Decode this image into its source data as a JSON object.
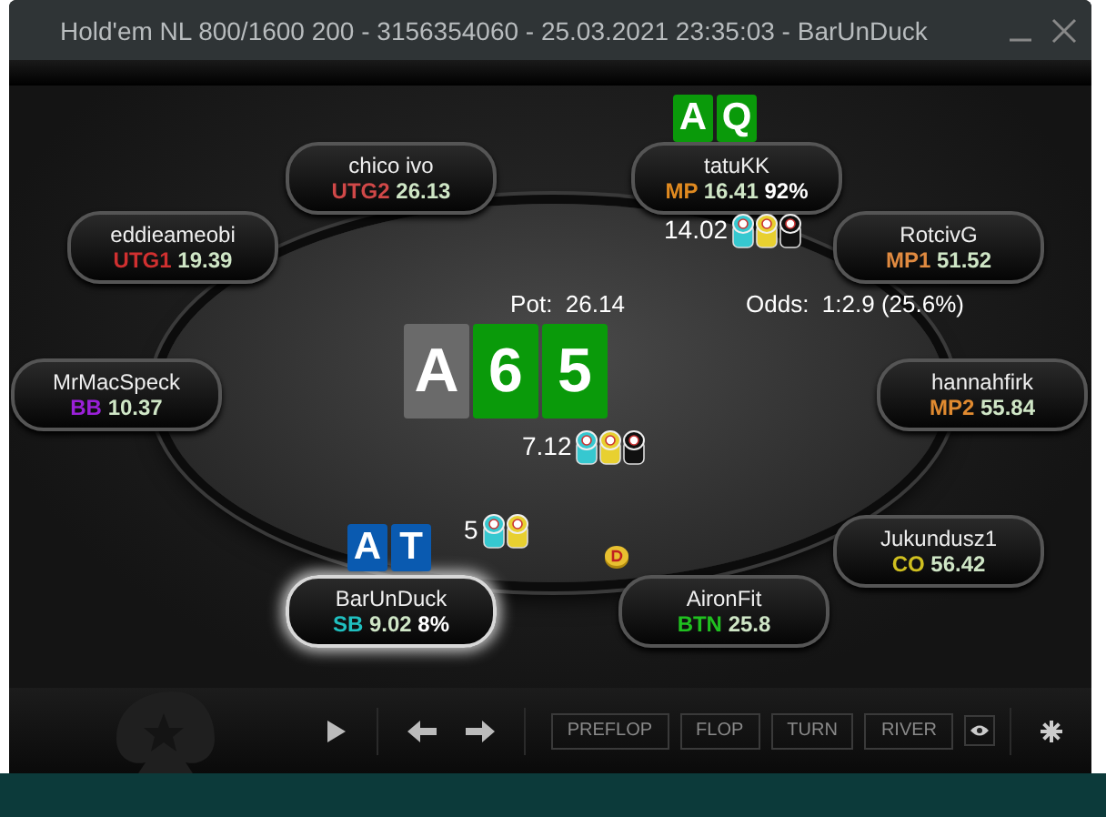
{
  "window": {
    "title": "Hold'em NL 800/1600 200 - 3156354060 - 25.03.2021 23:35:03 - BarUnDuck"
  },
  "seats": [
    {
      "name": "chico ivo",
      "position": "UTG2",
      "color": "#d04848",
      "stack": "26.13",
      "highlighted": false
    },
    {
      "name": "tatuKK",
      "position": "MP",
      "color": "#e08a20",
      "stack": "16.41",
      "equity": "92%",
      "highlighted": false,
      "cards": [
        {
          "rank": "A",
          "color": "#0a9a0a"
        },
        {
          "rank": "Q",
          "color": "#0a9a0a"
        }
      ]
    },
    {
      "name": "eddieameobi",
      "position": "UTG1",
      "color": "#d03030",
      "stack": "19.39",
      "highlighted": false
    },
    {
      "name": "RotcivG",
      "position": "MP1",
      "color": "#e08a40",
      "stack": "51.52",
      "highlighted": false
    },
    {
      "name": "MrMacSpeck",
      "position": "BB",
      "color": "#9a20d8",
      "stack": "10.37",
      "highlighted": false
    },
    {
      "name": "hannahfirk",
      "position": "MP2",
      "color": "#e08a30",
      "stack": "55.84",
      "highlighted": false
    },
    {
      "name": "BarUnDuck",
      "position": "SB",
      "color": "#20c0c0",
      "stack": "9.02",
      "equity": "8%",
      "highlighted": true,
      "cards": [
        {
          "rank": "A",
          "color": "#0a5ab0"
        },
        {
          "rank": "T",
          "color": "#0a5ab0"
        }
      ]
    },
    {
      "name": "AironFit",
      "position": "BTN",
      "color": "#20c020",
      "stack": "25.8",
      "highlighted": false
    },
    {
      "name": "Jukundusz1",
      "position": "CO",
      "color": "#d0c020",
      "stack": "56.42",
      "highlighted": false
    }
  ],
  "pot": {
    "label": "Pot:",
    "value": "26.14"
  },
  "odds": {
    "label": "Odds:",
    "value": "1:2.9 (25.6%)"
  },
  "board": [
    {
      "rank": "A",
      "color": "#6a6a6a"
    },
    {
      "rank": "6",
      "color": "#0a9a0a"
    },
    {
      "rank": "5",
      "color": "#0a9a0a"
    }
  ],
  "bets": [
    {
      "amount": "14.02"
    },
    {
      "amount": "7.12"
    },
    {
      "amount": "5"
    }
  ],
  "toolbar": {
    "streets": [
      "PREFLOP",
      "FLOP",
      "TURN",
      "RIVER"
    ]
  }
}
